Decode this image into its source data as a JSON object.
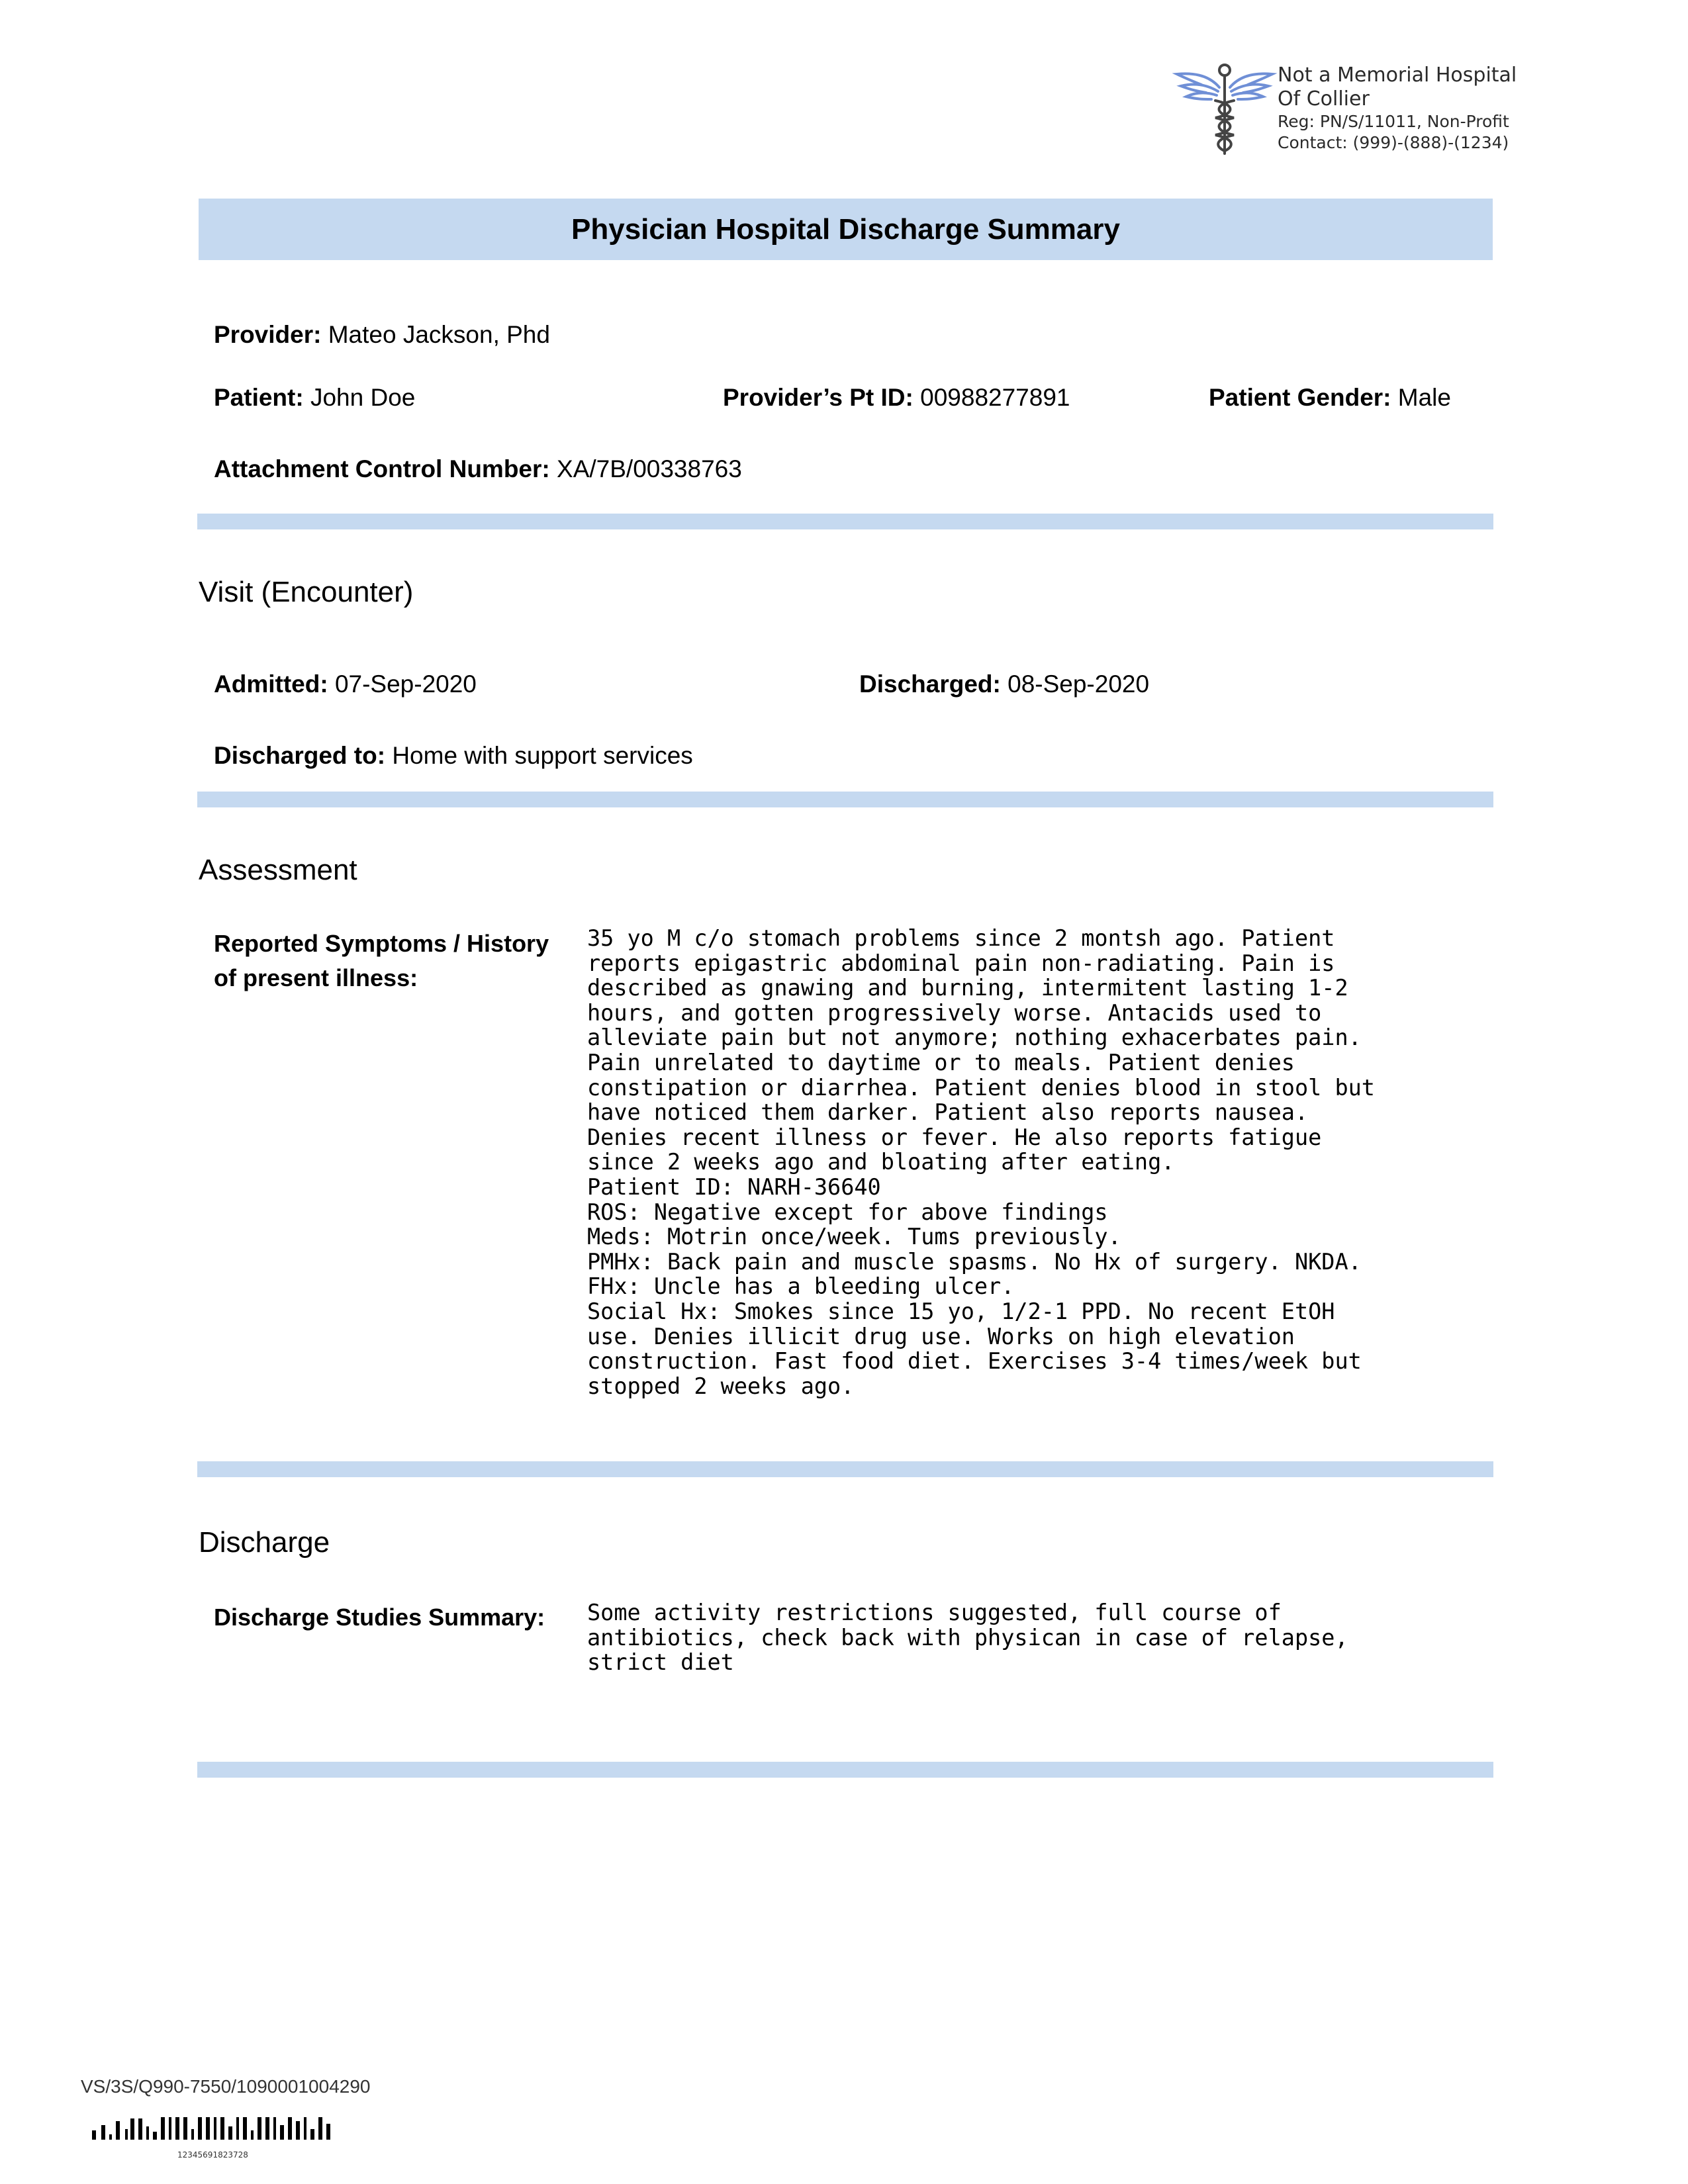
{
  "header": {
    "hospital_name_line1": "Not a Memorial Hospital",
    "hospital_name_line2": "Of Collier",
    "registration": "Reg: PN/S/11011, Non-Profit",
    "contact": "Contact: (999)-(888)-(1234)",
    "logo_icon": "caduceus-icon"
  },
  "title": "Physician Hospital Discharge Summary",
  "provider_info": {
    "provider_label": "Provider:",
    "provider_value": "Mateo Jackson, Phd",
    "patient_label": "Patient:",
    "patient_value": "John Doe",
    "pt_id_label": "Provider’s Pt ID:",
    "pt_id_value": "00988277891",
    "gender_label": "Patient Gender:",
    "gender_value": "Male",
    "acn_label": "Attachment Control Number:",
    "acn_value": "XA/7B/00338763"
  },
  "visit": {
    "heading": "Visit (Encounter)",
    "admitted_label": "Admitted:",
    "admitted_value": "07-Sep-2020",
    "discharged_label": "Discharged:",
    "discharged_value": "08-Sep-2020",
    "discharged_to_label": "Discharged to:",
    "discharged_to_value": "Home with support services"
  },
  "assessment": {
    "heading": "Assessment",
    "symptoms_label_line1": "Reported Symptoms / History",
    "symptoms_label_line2": "of present illness:",
    "symptoms_text": "35 yo M c/o stomach problems since 2 montsh ago. Patient\nreports epigastric abdominal pain non-radiating. Pain is\ndescribed as gnawing and burning, intermitent lasting 1-2\nhours, and gotten progressively worse. Antacids used to\nalleviate pain but not anymore; nothing exhacerbates pain.\nPain unrelated to daytime or to meals. Patient denies\nconstipation or diarrhea. Patient denies blood in stool but\nhave noticed them darker. Patient also reports nausea.\nDenies recent illness or fever. He also reports fatigue\nsince 2 weeks ago and bloating after eating.\nPatient ID: NARH-36640\nROS: Negative except for above findings\nMeds: Motrin once/week. Tums previously.\nPMHx: Back pain and muscle spasms. No Hx of surgery. NKDA.\nFHx: Uncle has a bleeding ulcer.\nSocial Hx: Smokes since 15 yo, 1/2-1 PPD. No recent EtOH\nuse. Denies illicit drug use. Works on high elevation\nconstruction. Fast food diet. Exercises 3-4 times/week but\nstopped 2 weeks ago."
  },
  "discharge": {
    "heading": "Discharge",
    "studies_label": "Discharge Studies Summary:",
    "studies_text": "Some activity restrictions suggested, full course of\nantibiotics, check back with physican in case of relapse,\nstrict diet"
  },
  "footer": {
    "code": "VS/3S/Q990-7550/1090001004290",
    "barcode_number": "12345691823728"
  }
}
